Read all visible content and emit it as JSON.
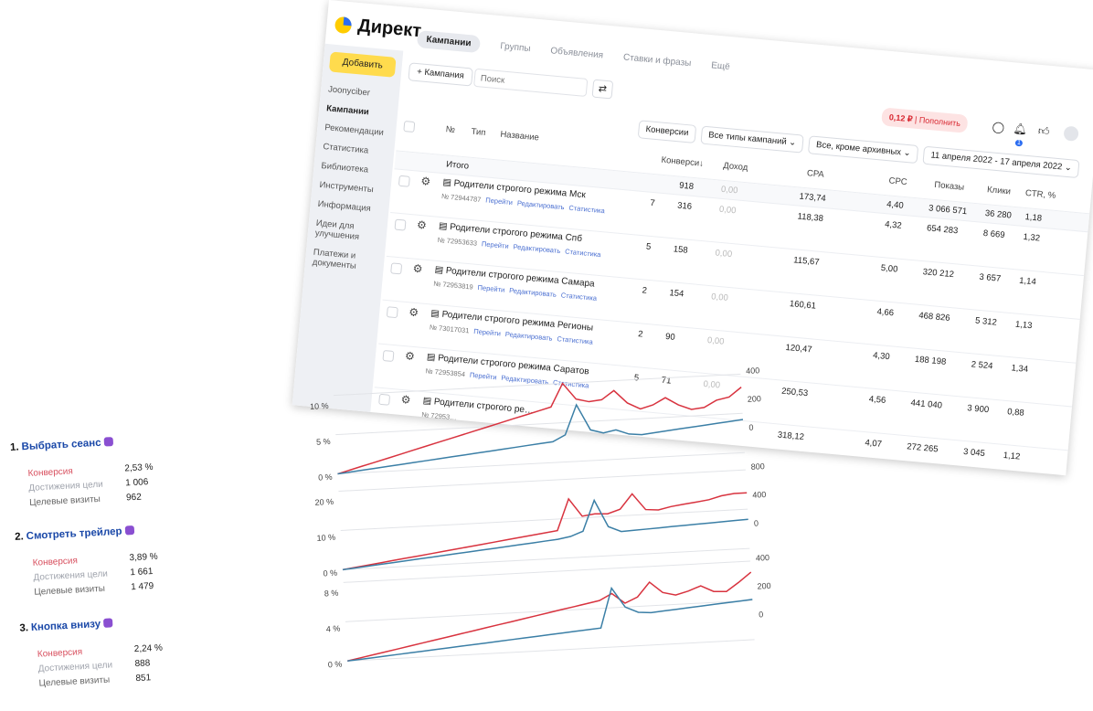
{
  "direct": {
    "logo_text": "Директ",
    "tabs": [
      {
        "label": "Кампании",
        "active": true
      },
      {
        "label": "Группы",
        "active": false
      },
      {
        "label": "Объявления",
        "active": false
      },
      {
        "label": "Ставки и фразы",
        "active": false
      },
      {
        "label": "Ещё",
        "active": false
      }
    ],
    "sidebar": {
      "add_button": "Добавить",
      "items": [
        {
          "label": "Joonyciber",
          "active": false
        },
        {
          "label": "Кампании",
          "active": true
        },
        {
          "label": "Рекомендации",
          "active": false
        },
        {
          "label": "Статистика",
          "active": false
        },
        {
          "label": "Библиотека",
          "active": false
        },
        {
          "label": "Инструменты",
          "active": false
        },
        {
          "label": "Информация",
          "active": false
        },
        {
          "label": "Идеи для улучшения",
          "active": false
        },
        {
          "label": "Платежи и документы",
          "active": false
        }
      ]
    },
    "toolbar": {
      "add_campaign": "+ Кампания",
      "search_placeholder": "Поиск",
      "balance_amount": "0,12 ₽",
      "balance_action": "Пополнить",
      "notification_count": "1"
    },
    "filters": [
      "Конверсии",
      "Все типы кампаний ⌄",
      "Все, кроме архивных ⌄",
      "11 апреля 2022 - 17 апреля 2022 ⌄"
    ],
    "table": {
      "headers": {
        "num": "№",
        "type": "Тип",
        "name": "Название",
        "conversions": "Конверси↓",
        "income": "Доход",
        "cpa": "CPA",
        "cpc": "CPC",
        "impressions": "Показы",
        "clicks": "Клики",
        "ctr": "CTR, %"
      },
      "total": {
        "label": "Итого",
        "conversions": "918",
        "income": "0,00",
        "cpa": "173,74",
        "cpc": "4,40",
        "impressions": "3 066 571",
        "clicks": "36 280",
        "ctr": "1,18"
      },
      "link_labels": {
        "open": "Перейти",
        "edit": "Редактировать",
        "stats": "Статистика"
      },
      "rows": [
        {
          "name": "Родители строгого режима Мск",
          "id": "№ 72944787",
          "cut": "7",
          "conversions": "316",
          "income": "0,00",
          "cpa": "118,38",
          "cpc": "4,32",
          "impressions": "654 283",
          "clicks": "8 669",
          "ctr": "1,32"
        },
        {
          "name": "Родители строгого режима Спб",
          "id": "№ 72953633",
          "cut": "5",
          "conversions": "158",
          "income": "0,00",
          "cpa": "115,67",
          "cpc": "5,00",
          "impressions": "320 212",
          "clicks": "3 657",
          "ctr": "1,14"
        },
        {
          "name": "Родители строгого режима Самара",
          "id": "№ 72953819",
          "cut": "2",
          "conversions": "154",
          "income": "0,00",
          "cpa": "160,61",
          "cpc": "4,66",
          "impressions": "468 826",
          "clicks": "5 312",
          "ctr": "1,13"
        },
        {
          "name": "Родители строгого режима Регионы",
          "id": "№ 73017031",
          "cut": "2",
          "conversions": "90",
          "income": "0,00",
          "cpa": "120,47",
          "cpc": "4,30",
          "impressions": "188 198",
          "clicks": "2 524",
          "ctr": "1,34"
        },
        {
          "name": "Родители строгого режима Саратов",
          "id": "№ 72953854",
          "cut": "5",
          "conversions": "71",
          "income": "0,00",
          "cpa": "250,53",
          "cpc": "4,56",
          "impressions": "441 040",
          "clicks": "3 900",
          "ctr": "0,88"
        },
        {
          "name": "Родители строгого ре…",
          "id": "№ 72953…",
          "cut": "",
          "conversions": "",
          "income": "",
          "cpa": "318,12",
          "cpc": "4,07",
          "impressions": "272 265",
          "clicks": "3 045",
          "ctr": "1,12"
        }
      ]
    }
  },
  "goals": [
    {
      "index": "1.",
      "title": "Выбрать сеанс",
      "conv_label": "Конверсия",
      "conv": "2,53 %",
      "reach_label": "Достижения цели",
      "reach": "1 006",
      "visits_label": "Целевые визиты",
      "visits": "962"
    },
    {
      "index": "2.",
      "title": "Смотреть трейлер",
      "conv_label": "Конверсия",
      "conv": "3,89 %",
      "reach_label": "Достижения цели",
      "reach": "1 661",
      "visits_label": "Целевые визиты",
      "visits": "1 479"
    },
    {
      "index": "3.",
      "title": "Кнопка внизу",
      "conv_label": "Конверсия",
      "conv": "2,24 %",
      "reach_label": "Достижения цели",
      "reach": "888",
      "visits_label": "Целевые визиты",
      "visits": "851"
    }
  ],
  "chart_data": [
    {
      "type": "line",
      "left_ticks": [
        "10 %",
        "5 %",
        "0 %"
      ],
      "left_ylim": [
        0,
        12
      ],
      "right_ticks": [
        "400",
        "200",
        "0"
      ],
      "right_ylim": [
        -160,
        480
      ],
      "colors": {
        "conversion": "#d8333f",
        "visits": "#3b7fa6"
      },
      "series": [
        {
          "axis": "left",
          "values": [
            0.0,
            0.5,
            1.0,
            1.5,
            2.0,
            2.5,
            3.0,
            3.5,
            4.0,
            4.5,
            5.0,
            5.5,
            6.0,
            6.5,
            7.0,
            7.5,
            8.0,
            8.5,
            12.0,
            9.5,
            9.0,
            9.2,
            10.5,
            8.5,
            7.5,
            8.0,
            9.0,
            7.8,
            7.0,
            7.2,
            8.2,
            8.6,
            10.0
          ]
        },
        {
          "axis": "right",
          "values": [
            -160,
            -150,
            -140,
            -130,
            -120,
            -110,
            -100,
            -90,
            -80,
            -70,
            -60,
            -50,
            -40,
            -30,
            -20,
            -10,
            0,
            10,
            60,
            300,
            90,
            60,
            80,
            40,
            30,
            40,
            50,
            60,
            70,
            80,
            90,
            100,
            110
          ]
        }
      ]
    },
    {
      "type": "line",
      "left_ticks": [
        "20 %",
        "10 %",
        "0 %"
      ],
      "left_ylim": [
        0,
        24
      ],
      "right_ticks": [
        "800",
        "400",
        "0"
      ],
      "right_ylim": [
        -400,
        1000
      ],
      "colors": {
        "conversion": "#d8333f",
        "visits": "#3b7fa6"
      },
      "series": [
        {
          "axis": "left",
          "values": [
            0.0,
            0.5,
            1.0,
            1.5,
            2.0,
            2.5,
            3.0,
            3.5,
            4.0,
            4.5,
            5.0,
            5.5,
            6.0,
            6.5,
            7.0,
            7.5,
            8.0,
            8.5,
            18.0,
            12.5,
            13.0,
            12.8,
            14.0,
            18.5,
            13.5,
            13.2,
            14.0,
            14.5,
            15.0,
            15.5,
            16.5,
            17.0,
            17.0
          ]
        },
        {
          "axis": "right",
          "values": [
            -400,
            -380,
            -360,
            -340,
            -320,
            -300,
            -280,
            -260,
            -240,
            -220,
            -200,
            -180,
            -160,
            -140,
            -120,
            -100,
            -80,
            -60,
            -20,
            60,
            600,
            120,
            20,
            30,
            40,
            50,
            60,
            70,
            80,
            90,
            100,
            110,
            120
          ]
        }
      ]
    },
    {
      "type": "line",
      "left_ticks": [
        "8 %",
        "4 %",
        "0 %"
      ],
      "left_ylim": [
        0,
        10
      ],
      "right_ticks": [
        "400",
        "200",
        "0"
      ],
      "right_ylim": [
        -300,
        500
      ],
      "colors": {
        "conversion": "#d8333f",
        "visits": "#3b7fa6"
      },
      "series": [
        {
          "axis": "left",
          "values": [
            0.0,
            0.3,
            0.6,
            0.9,
            1.2,
            1.5,
            1.8,
            2.1,
            2.4,
            2.7,
            3.0,
            3.3,
            3.6,
            3.9,
            4.2,
            4.5,
            4.8,
            5.1,
            5.4,
            5.7,
            6.0,
            6.8,
            5.5,
            6.2,
            8.0,
            6.6,
            6.2,
            6.6,
            7.2,
            6.4,
            6.3,
            7.4,
            8.6
          ]
        },
        {
          "axis": "right",
          "values": [
            -300,
            -290,
            -280,
            -270,
            -260,
            -250,
            -240,
            -230,
            -220,
            -210,
            -200,
            -190,
            -180,
            -170,
            -160,
            -150,
            -140,
            -130,
            -120,
            -110,
            -100,
            300,
            100,
            40,
            30,
            40,
            50,
            60,
            70,
            80,
            90,
            100,
            110
          ]
        }
      ]
    }
  ]
}
